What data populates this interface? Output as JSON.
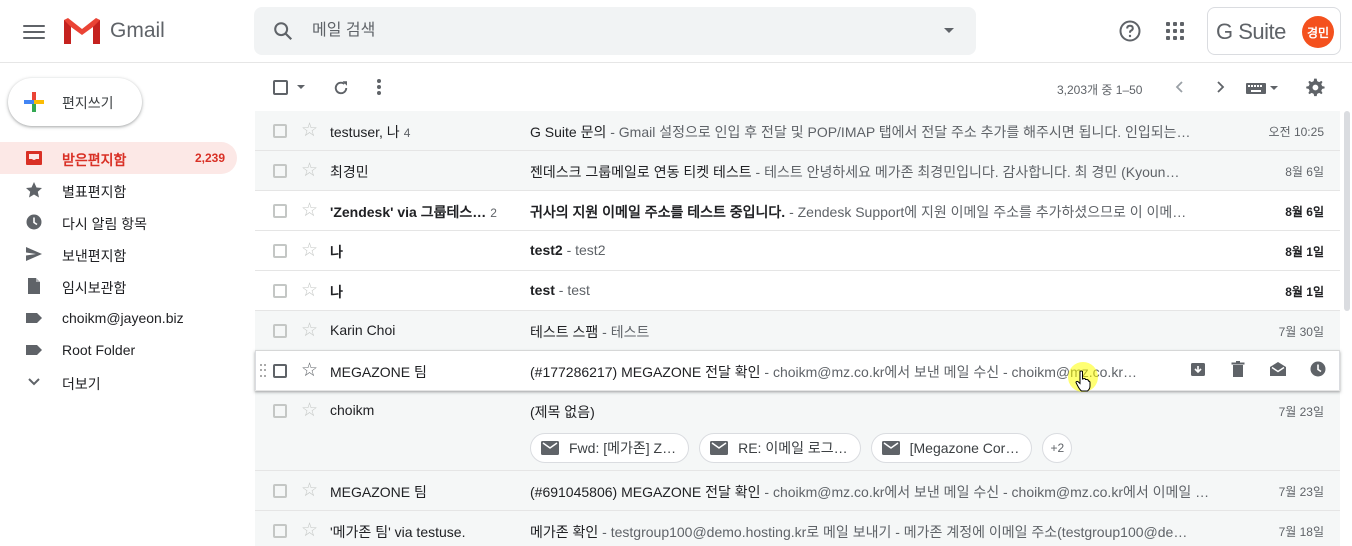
{
  "header": {
    "app_name": "Gmail",
    "search_placeholder": "메일 검색",
    "gsuite_label": "G Suite",
    "avatar_text": "경민"
  },
  "sidebar": {
    "compose_label": "편지쓰기",
    "items": [
      {
        "label": "받은편지함",
        "count": "2,239",
        "icon": "inbox-icon"
      },
      {
        "label": "별표편지함",
        "count": "",
        "icon": "star-icon"
      },
      {
        "label": "다시 알림 항목",
        "count": "",
        "icon": "clock-icon"
      },
      {
        "label": "보낸편지함",
        "count": "",
        "icon": "send-icon"
      },
      {
        "label": "임시보관함",
        "count": "",
        "icon": "draft-icon"
      },
      {
        "label": "choikm@jayeon.biz",
        "count": "",
        "icon": "label-icon"
      },
      {
        "label": "Root Folder",
        "count": "",
        "icon": "label-icon"
      },
      {
        "label": "더보기",
        "count": "",
        "icon": "chevron-down-icon"
      }
    ]
  },
  "toolbar": {
    "range": "3,203개 중 1–50"
  },
  "emails": [
    {
      "sender": "testuser, 나",
      "count": "4",
      "subject": "G Suite 문의",
      "snippet": " - Gmail 설정으로 인입 후 전달 및 POP/IMAP 탭에서 전달 주소 추가를 해주시면 됩니다. 인입되는…",
      "date": "오전 10:25"
    },
    {
      "sender": "최경민",
      "count": "",
      "subject": "젠데스크 그룹메일로 연동 티켓 테스트",
      "snippet": " - 테스트 안녕하세요 메가존 최경민입니다. 감사합니다. 최 경민 (Kyoun…",
      "date": "8월 6일"
    },
    {
      "sender": "'Zendesk' via 그룹테스…",
      "count": "2",
      "subject": "귀사의 지원 이메일 주소를 테스트 중입니다.",
      "snippet": " - Zendesk Support에 지원 이메일 주소를 추가하셨으므로 이 이메…",
      "date": "8월 6일"
    },
    {
      "sender": "나",
      "count": "",
      "subject": "test2",
      "snippet": " - test2",
      "date": "8월 1일"
    },
    {
      "sender": "나",
      "count": "",
      "subject": "test",
      "snippet": " - test",
      "date": "8월 1일"
    },
    {
      "sender": "Karin Choi",
      "count": "",
      "subject": "테스트 스팸",
      "snippet": " - 테스트",
      "date": "7월 30일"
    },
    {
      "sender": "MEGAZONE 팀",
      "count": "",
      "subject": "(#177286217) MEGAZONE 전달 확인",
      "snippet": " - choikm@mz.co.kr에서 보낸 메일 수신 - choikm@mz.co.kr…",
      "date": ""
    },
    {
      "sender": "choikm",
      "count": "",
      "subject": "(제목 없음)",
      "snippet": "",
      "date": "7월 23일"
    },
    {
      "sender": "MEGAZONE 팀",
      "count": "",
      "subject": "(#691045806) MEGAZONE 전달 확인",
      "snippet": " - choikm@mz.co.kr에서 보낸 메일 수신 - choikm@mz.co.kr에서 이메일 …",
      "date": "7월 23일"
    },
    {
      "sender": "'메가존 팀' via testuse.",
      "count": "",
      "subject": "메가존 확인",
      "snippet": " - testgroup100@demo.hosting.kr로 메일 보내기 - 메가존 계정에 이메일 주소(testgroup100@de…",
      "date": "7월 18일"
    }
  ],
  "attachments": [
    "Fwd: [메가존] Z…",
    "RE: 이메일 로그…",
    "[Megazone Cor…",
    "+2"
  ],
  "colors": {
    "accent": "#d93025",
    "avatar": "#f4511e"
  }
}
